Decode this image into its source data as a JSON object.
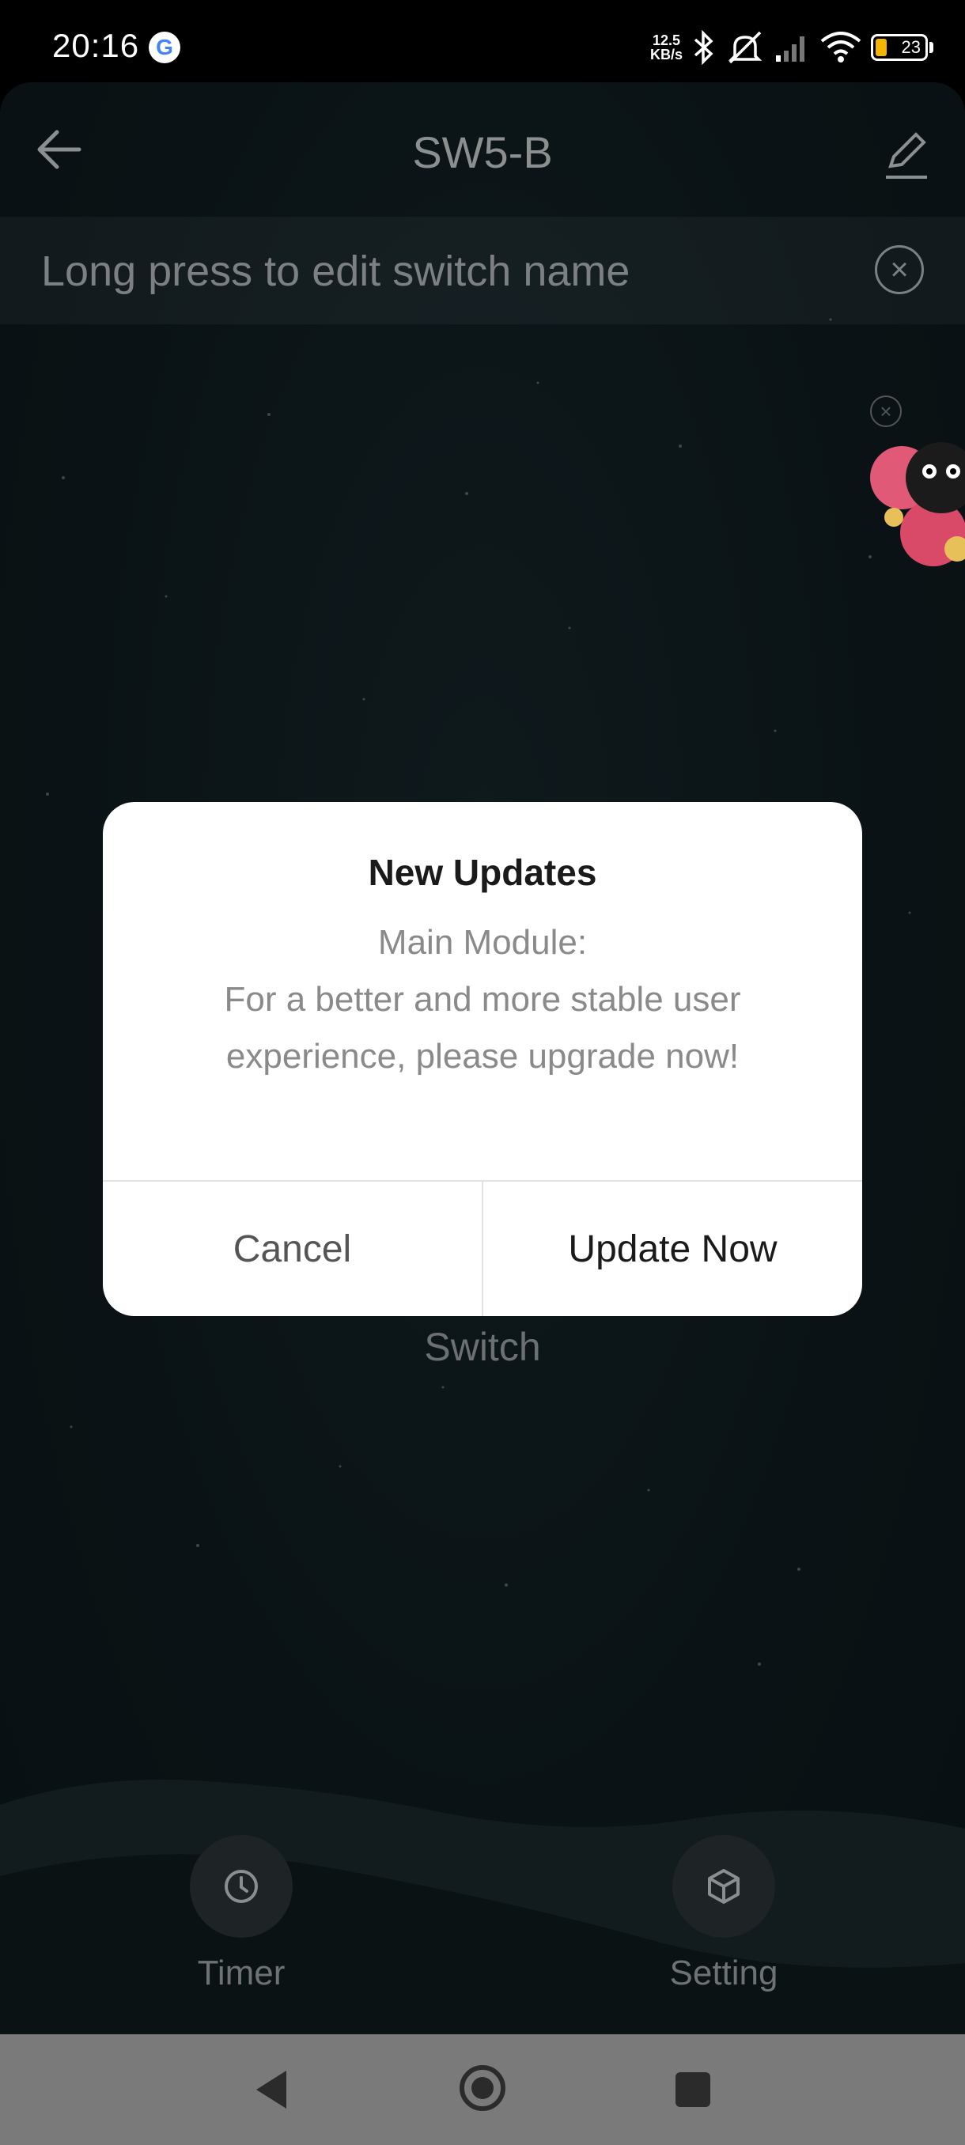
{
  "status_bar": {
    "time": "20:16",
    "net_speed_value": "12.5",
    "net_speed_unit": "KB/s",
    "battery_level": "23",
    "icons": [
      "google-icon",
      "bluetooth-icon",
      "mute-icon",
      "signal-icon",
      "wifi-icon",
      "battery-icon"
    ]
  },
  "header": {
    "title": "SW5-B"
  },
  "notice": {
    "text": "Long press to edit switch name"
  },
  "main": {
    "switch_label": "Switch"
  },
  "bottom_tabs": [
    {
      "label": "Timer",
      "icon": "clock-icon"
    },
    {
      "label": "Setting",
      "icon": "cube-icon"
    }
  ],
  "dialog": {
    "title": "New Updates",
    "line1": "Main Module:",
    "line2": "For a better and more stable user",
    "line3": "experience, please upgrade now!",
    "cancel_label": "Cancel",
    "confirm_label": "Update Now"
  },
  "colors": {
    "dialog_bg": "#ffffff",
    "nav_bar": "#7a7a7a",
    "battery_fill": "#f4b400"
  }
}
